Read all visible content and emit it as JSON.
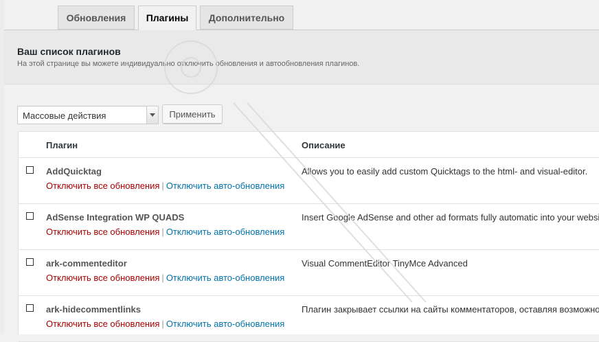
{
  "tabs": [
    {
      "label": "Обновления",
      "active": false
    },
    {
      "label": "Плагины",
      "active": true
    },
    {
      "label": "Дополнительно",
      "active": false
    }
  ],
  "panel": {
    "title": "Ваш список плагинов",
    "description": "На этой странице вы можете индивидуально отключить обновления и автообновления плагинов."
  },
  "bulk": {
    "selected": "Массовые действия",
    "apply_label": "Применить"
  },
  "table": {
    "columns": [
      "Плагин",
      "Описание"
    ],
    "rows": [
      {
        "name": "AddQuicktag",
        "disable_all": "Отключить все обновления",
        "separator": "|",
        "disable_auto": "Отключить авто-обновления",
        "description": "Allows you to easily add custom Quicktags to the html- and visual-editor."
      },
      {
        "name": "AdSense Integration WP QUADS",
        "disable_all": "Отключить все обновления",
        "separator": "|",
        "disable_auto": "Отключить авто-обновления",
        "description": "Insert Google AdSense and other ad formats fully automatic into your website"
      },
      {
        "name": "ark-commenteditor",
        "disable_all": "Отключить все обновления",
        "separator": "|",
        "disable_auto": "Отключить авто-обновления",
        "description": "Visual CommentEditor TinyMce Advanced"
      },
      {
        "name": "ark-hidecommentlinks",
        "disable_all": "Отключить все обновления",
        "separator": "|",
        "disable_auto": "Отключить авто-обновления",
        "description": "Плагин закрывает ссылки на сайты комментаторов, оставляя возможность"
      }
    ]
  },
  "colors": {
    "disable_all_link": "#aa0000",
    "disable_auto_link": "#0073aa"
  }
}
